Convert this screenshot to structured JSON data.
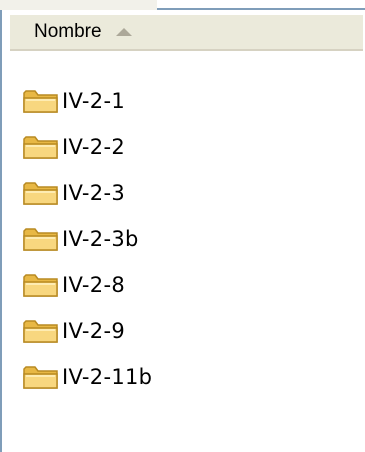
{
  "header": {
    "column_name": "Nombre"
  },
  "icons": {
    "sort": "sort-ascending-icon",
    "item": "folder-icon"
  },
  "colors": {
    "header_bg": "#ebeadb",
    "folder_fill": "#f6d27a",
    "folder_stroke": "#c9962a",
    "border_blue": "#7f9db9"
  },
  "folders": [
    {
      "name": "IV-2-1"
    },
    {
      "name": "IV-2-2"
    },
    {
      "name": "IV-2-3"
    },
    {
      "name": "IV-2-3b"
    },
    {
      "name": "IV-2-8"
    },
    {
      "name": "IV-2-9"
    },
    {
      "name": "IV-2-11b"
    }
  ]
}
